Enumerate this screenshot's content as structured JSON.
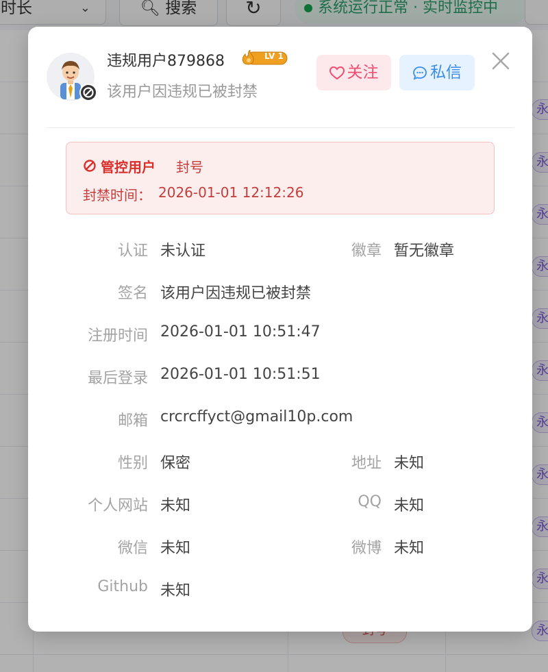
{
  "background": {
    "filter_select": "时长",
    "search_button": "搜索",
    "status_pill": "系统运行正常 · 实时监控中",
    "perm_tag": "永久",
    "ban_tag": "封号"
  },
  "colors": {
    "danger": "#d9302c",
    "follow": "#f04d6f",
    "message": "#3a8dea",
    "level_badge": "#f0a020"
  },
  "profile": {
    "username": "违规用户879868",
    "level": "LV 1",
    "subtitle": "该用户因违规已被封禁",
    "follow_label": "关注",
    "message_label": "私信"
  },
  "alert": {
    "title": "管控用户",
    "reason": "封号",
    "time_label": "封禁时间：",
    "time_value": "2026-01-01 12:12:26"
  },
  "info": {
    "verify_label": "认证",
    "verify_value": "未认证",
    "badge_label": "徽章",
    "badge_value": "暂无徽章",
    "signature_label": "签名",
    "signature_value": "该用户因违规已被封禁",
    "register_label": "注册时间",
    "register_value": "2026-01-01 10:51:47",
    "lastlogin_label": "最后登录",
    "lastlogin_value": "2026-01-01 10:51:51",
    "email_label": "邮箱",
    "email_value": "crcrcffyct@gmail10p.com",
    "gender_label": "性别",
    "gender_value": "保密",
    "address_label": "地址",
    "address_value": "未知",
    "website_label": "个人网站",
    "website_value": "未知",
    "qq_label": "QQ",
    "qq_value": "未知",
    "wechat_label": "微信",
    "wechat_value": "未知",
    "weibo_label": "微博",
    "weibo_value": "未知",
    "github_label": "Github",
    "github_value": "未知"
  }
}
